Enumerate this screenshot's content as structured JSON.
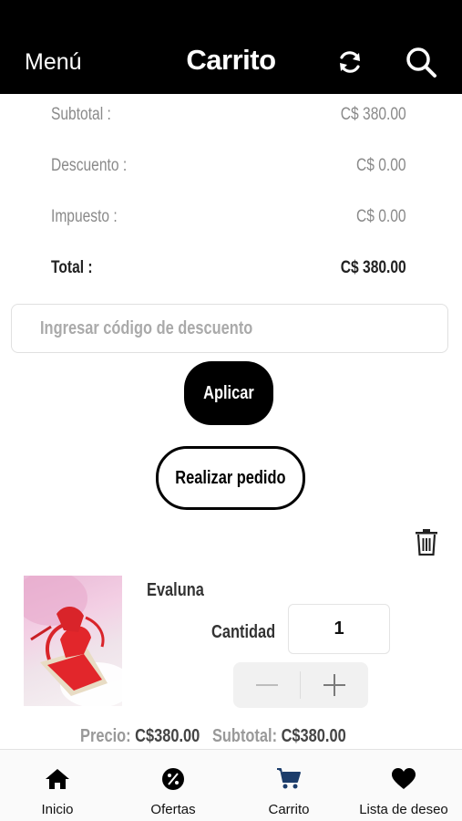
{
  "header": {
    "menu_label": "Menú",
    "title": "Carrito",
    "refresh_icon": "refresh-icon",
    "search_icon": "search-icon"
  },
  "summary": {
    "subtotal_label": "Subtotal :",
    "subtotal_value": "C$ 380.00",
    "discount_label": "Descuento :",
    "discount_value": "C$ 0.00",
    "tax_label": "Impuesto :",
    "tax_value": "C$ 0.00",
    "total_label": "Total :",
    "total_value": "C$ 380.00"
  },
  "discount": {
    "placeholder": "Ingresar código de descuento",
    "apply_label": "Aplicar"
  },
  "order_button_label": "Realizar pedido",
  "cart_item": {
    "name": "Evaluna",
    "quantity_label": "Cantidad",
    "quantity": "1",
    "price_label": "Precio:",
    "price_value": "C$380.00",
    "subtotal_label": "Subtotal:",
    "subtotal_value": "C$380.00",
    "image_description": "red espadrille sandal"
  },
  "tabs": [
    {
      "label": "Inicio",
      "icon": "home-icon"
    },
    {
      "label": "Ofertas",
      "icon": "discount-badge-icon"
    },
    {
      "label": "Carrito",
      "icon": "cart-icon",
      "active": true
    },
    {
      "label": "Lista de deseo",
      "icon": "heart-icon"
    }
  ],
  "colors": {
    "header_bg": "#000000",
    "active_tab": "#1c3d6b",
    "muted_text": "#8a8a8a"
  }
}
